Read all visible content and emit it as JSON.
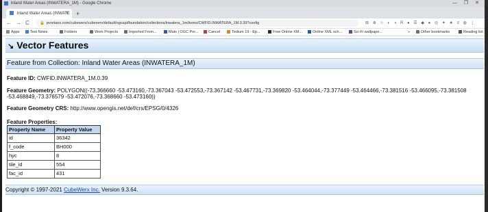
{
  "window": {
    "title": "Inland Water Areas (INWATERA_1M) - Google Chrome",
    "controls": "— ❐ ✕"
  },
  "tabs": [
    {
      "label": "Inland Water Areas (INWATE",
      "close": "×"
    }
  ],
  "new_tab": "+",
  "toolbar": {
    "back": "←",
    "forward": "→",
    "reload": "C",
    "url": "pvretano.com/cubewerx/cubeserv/default/ogcapi/foundation/collections/inwatera_1m/items/CWFID.INWATERA_1M.0.39?config",
    "extensions": "⊞ ⊕ ☆ ◐ ◑ R ● ☰ ◆ ● ◎ ✦ ★ ≡ ◍ ⋮"
  },
  "bookmarks": [
    {
      "icon": "apps-icon",
      "label": "Apps"
    },
    {
      "icon": "news-icon",
      "label": "Test News"
    },
    {
      "icon": "folder-icon",
      "label": "Folders"
    },
    {
      "icon": "folder-icon",
      "label": "Work Projects"
    },
    {
      "icon": "folder-icon",
      "label": "Imported From..."
    },
    {
      "icon": "page-icon",
      "label": "Main | OGC Por..."
    },
    {
      "icon": "page-icon",
      "label": "Cancel"
    },
    {
      "icon": "page-icon",
      "label": "Tedium 19 - Ep..."
    },
    {
      "icon": "page-icon",
      "label": "Free Online XM..."
    },
    {
      "icon": "page-icon",
      "label": "Online XML sch..."
    },
    {
      "icon": "page-icon",
      "label": "Sci-Fi wallpape..."
    },
    {
      "icon": "chevron-icon",
      "label": "»"
    },
    {
      "icon": "folder-icon",
      "label": "Other bookmarks"
    },
    {
      "icon": "list-icon",
      "label": "Reading list"
    }
  ],
  "page": {
    "title_marker": "↘",
    "title": "Vector Features",
    "collection_heading": "Feature from Collection: Inland Water Areas (INWATERA_1M)",
    "feature_id_label": "Feature ID:",
    "feature_id": "CWFID.INWATERA_1M.0.39",
    "geometry_label": "Feature Geometry:",
    "geometry": "POLYGON((-73.366660 -53.473160,-73.367043 -53.472553,-73.367142 -53.467731,-73.369820 -53.464044,-73.377449 -53.464466,-73.381516 -53.466095,-73.381508 -53.468849,-73.376579 -53.472076,-73.368660 -53.473160))",
    "crs_label": "Feature Geometry CRS:",
    "crs": "http://www.opengis.net/def/crs/EPSG/0/4326",
    "properties_label": "Feature Properties:",
    "properties_headers": [
      "Property Name",
      "Property Value"
    ],
    "properties": [
      {
        "name": "id",
        "value": "36342"
      },
      {
        "name": "f_code",
        "value": "BH000"
      },
      {
        "name": "hyc",
        "value": "8"
      },
      {
        "name": "tile_id",
        "value": "554"
      },
      {
        "name": "fac_id",
        "value": "431"
      }
    ]
  },
  "footer": {
    "prefix": "Copyright © 1997-2021 ",
    "link": "CubeWerx Inc.",
    "suffix": " Version 9.3.64."
  }
}
